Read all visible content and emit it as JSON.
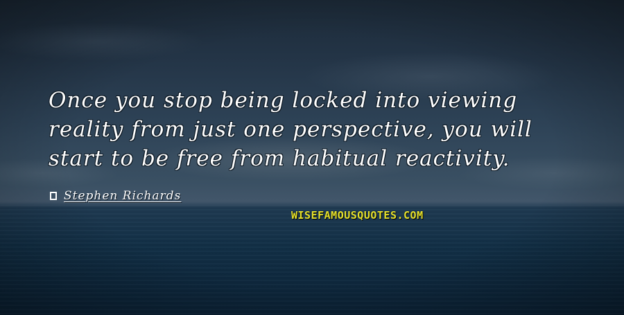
{
  "quote": {
    "text": "Once you stop being locked into viewing reality from just one perspective, you will start to be free from habitual reactivity."
  },
  "author": {
    "name": "Stephen Richards"
  },
  "watermark": {
    "text": "WISEFAMOUSQUOTES.COM",
    "color": "#e6e12a"
  }
}
